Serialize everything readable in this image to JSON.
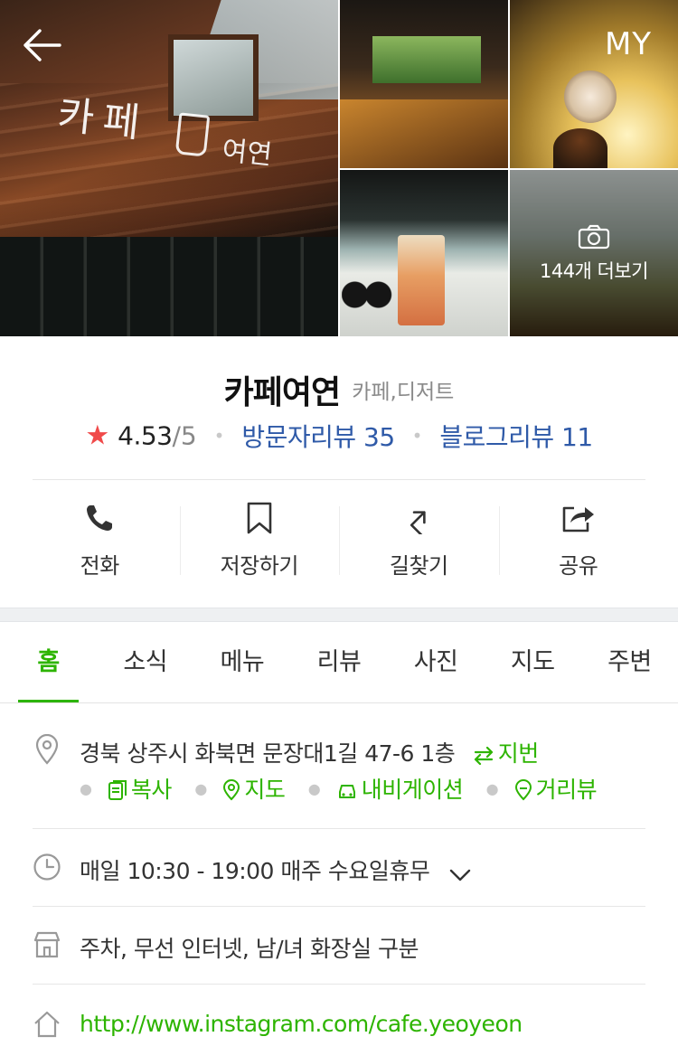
{
  "nav": {
    "my_label": "MY"
  },
  "gallery": {
    "main_sign_text": "카페",
    "main_sign_text2": "여연",
    "more_label": "144개 더보기"
  },
  "place": {
    "name": "카페여연",
    "category": "카페,디저트",
    "rating": "4.53",
    "rating_max": "/5",
    "visitor_review": "방문자리뷰 35",
    "blog_review": "블로그리뷰 11"
  },
  "actions": [
    {
      "label": "전화",
      "icon": "phone-icon"
    },
    {
      "label": "저장하기",
      "icon": "bookmark-icon"
    },
    {
      "label": "길찾기",
      "icon": "directions-icon"
    },
    {
      "label": "공유",
      "icon": "share-icon"
    }
  ],
  "tabs": [
    {
      "label": "홈",
      "active": true
    },
    {
      "label": "소식"
    },
    {
      "label": "메뉴"
    },
    {
      "label": "리뷰"
    },
    {
      "label": "사진"
    },
    {
      "label": "지도"
    },
    {
      "label": "주변"
    }
  ],
  "info": {
    "address": "경북 상주시 화북면 문장대1길 47-6 1층",
    "jibun_label": "지번",
    "addr_actions": [
      "복사",
      "지도",
      "내비게이션",
      "거리뷰"
    ],
    "hours": "매일 10:30 - 19:00 매주 수요일휴무",
    "amenities": "주차, 무선 인터넷, 남/녀 화장실 구분",
    "homepage": "http://www.instagram.com/cafe.yeoyeon"
  },
  "colors": {
    "accent_green": "#2db400",
    "link_blue": "#2f5aa8",
    "star_red": "#f04a4a"
  }
}
